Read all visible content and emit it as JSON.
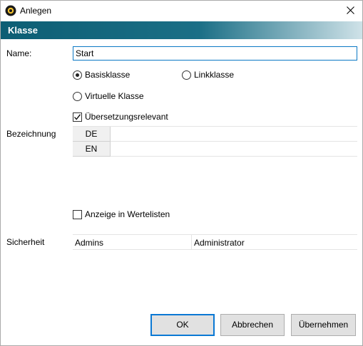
{
  "window": {
    "title": "Anlegen"
  },
  "header": {
    "title": "Klasse"
  },
  "form": {
    "name_label": "Name:",
    "name_value": "Start",
    "radio_basis": "Basisklasse",
    "radio_link": "Linkklasse",
    "radio_virtual": "Virtuelle Klasse",
    "selected_type": "Basisklasse",
    "check_translation": "Übersetzungsrelevant",
    "check_translation_checked": true,
    "bezeichnung_label": "Bezeichnung",
    "languages": [
      {
        "code": "DE",
        "value": ""
      },
      {
        "code": "EN",
        "value": ""
      }
    ],
    "check_valuelists": "Anzeige in Wertelisten",
    "check_valuelists_checked": false,
    "security_label": "Sicherheit",
    "security_row": {
      "group": "Admins",
      "role": "Administrator"
    }
  },
  "buttons": {
    "ok": "OK",
    "cancel": "Abbrechen",
    "apply": "Übernehmen"
  },
  "colors": {
    "header_band": "#0d5e74",
    "focus": "#0a78d4"
  },
  "icons": {
    "app": "app-logo-icon",
    "close": "close-icon"
  }
}
